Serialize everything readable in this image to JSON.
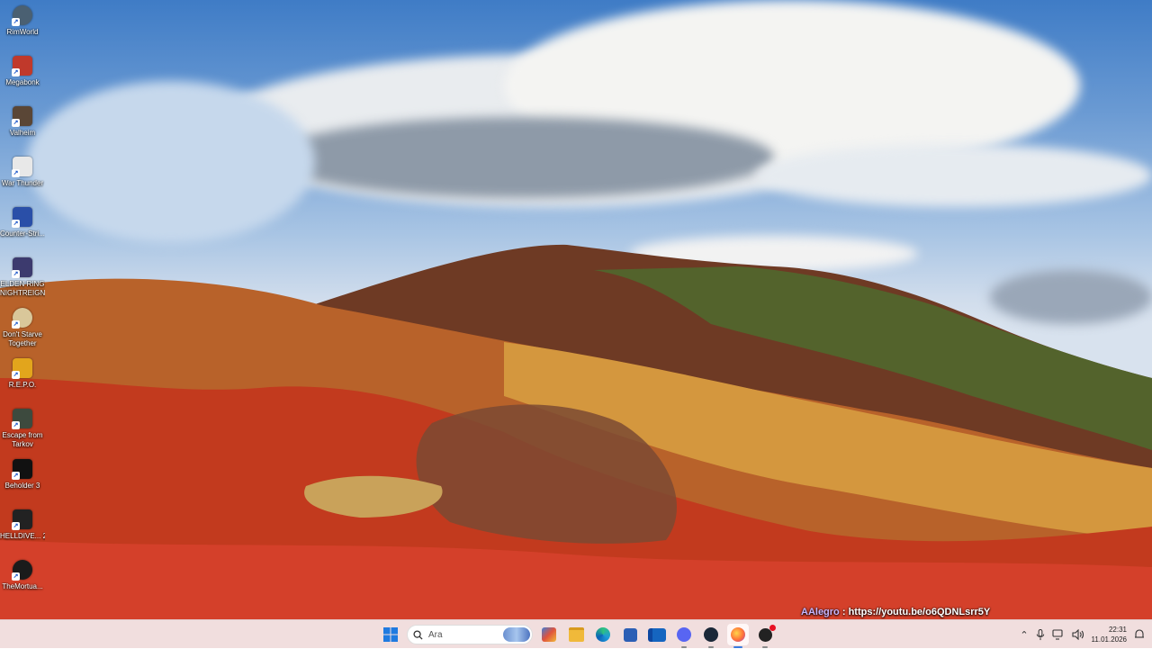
{
  "desktop_icons": [
    {
      "label": "RimWorld",
      "icon": "rimworld-icon",
      "color": "#4a6072"
    },
    {
      "label": "Megabonk",
      "icon": "megabonk-icon",
      "color": "#c0392b"
    },
    {
      "label": "Valheim",
      "icon": "valheim-icon",
      "color": "#5a4636"
    },
    {
      "label": "War Thunder",
      "icon": "war-thunder-icon",
      "color": "#e8e8e8"
    },
    {
      "label": "Counter-Stri... 2",
      "icon": "counter-strike-icon",
      "color": "#2a4fa8"
    },
    {
      "label": "ELDEN RING NIGHTREIGN",
      "icon": "elden-ring-icon",
      "color": "#3c3a6e"
    },
    {
      "label": "Don't Starve Together",
      "icon": "dont-starve-icon",
      "color": "#d9c79a"
    },
    {
      "label": "R.E.P.O.",
      "icon": "repo-icon",
      "color": "#e2a51c"
    },
    {
      "label": "Escape from Tarkov",
      "icon": "tarkov-icon",
      "color": "#3d4a3e"
    },
    {
      "label": "Beholder 3",
      "icon": "beholder-icon",
      "color": "#111111"
    },
    {
      "label": "HELLDIVE... 2",
      "icon": "helldivers-icon",
      "color": "#222222"
    },
    {
      "label": "TheMortua...",
      "icon": "mortuary-icon",
      "color": "#1b1b1b"
    }
  ],
  "overlay": {
    "name": "AAlegro",
    "separator": " : ",
    "link": "https://youtu.be/o6QDNLsrr5Y"
  },
  "taskbar": {
    "search_placeholder": "Ara",
    "apps": [
      {
        "name": "widgets",
        "icon": "widgets-icon",
        "color": "#3f7ed8"
      },
      {
        "name": "file-explorer",
        "icon": "folder-icon",
        "color": "#f0b93a"
      },
      {
        "name": "edge",
        "icon": "edge-icon",
        "color": "#1f9bd8"
      },
      {
        "name": "store",
        "icon": "store-icon",
        "color": "#2c5fb5"
      },
      {
        "name": "outlook",
        "icon": "outlook-icon",
        "color": "#1565c0"
      },
      {
        "name": "discord",
        "icon": "discord-icon",
        "color": "#5865f2"
      },
      {
        "name": "steam",
        "icon": "steam-icon",
        "color": "#1b2838"
      },
      {
        "name": "firefox",
        "icon": "firefox-icon",
        "color": "#ff7139"
      },
      {
        "name": "app-with-badge",
        "icon": "app-icon",
        "color": "#222222"
      }
    ],
    "time": "22:31",
    "date": "11.01.2026"
  }
}
